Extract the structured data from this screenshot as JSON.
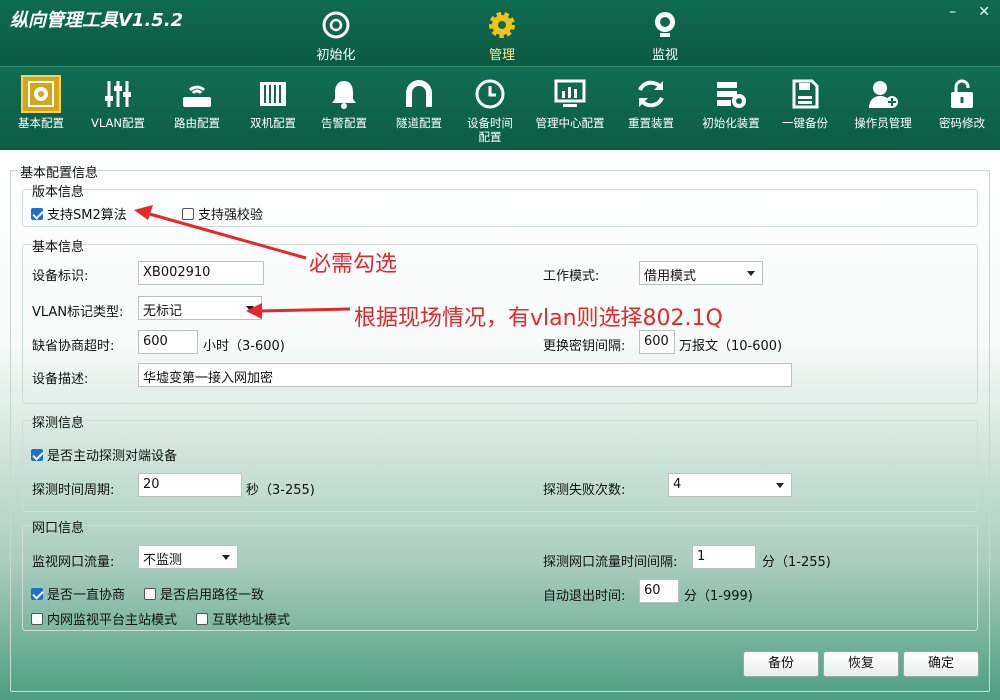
{
  "app": {
    "title": "纵向管理工具V1.5.2",
    "minimize": "–",
    "close": "✕"
  },
  "main_tabs": [
    {
      "label": "初始化",
      "icon": "init-icon"
    },
    {
      "label": "管理",
      "icon": "gear-icon"
    },
    {
      "label": "监视",
      "icon": "camera-icon"
    }
  ],
  "toolbar": [
    {
      "label": "基本配置",
      "icon": "basic-config-icon"
    },
    {
      "label": "VLAN配置",
      "icon": "sliders-icon"
    },
    {
      "label": "路由配置",
      "icon": "router-icon"
    },
    {
      "label": "双机配置",
      "icon": "dual-machine-icon"
    },
    {
      "label": "告警配置",
      "icon": "bell-icon"
    },
    {
      "label": "隧道配置",
      "icon": "tunnel-icon"
    },
    {
      "label": "设备时间",
      "label2": "配置",
      "icon": "clock-icon"
    },
    {
      "label": "管理中心配置",
      "icon": "monitor-icon"
    },
    {
      "label": "重置装置",
      "icon": "refresh-icon"
    },
    {
      "label": "初始化装置",
      "icon": "device-gear-icon"
    },
    {
      "label": "一键备份",
      "icon": "floppy-icon"
    },
    {
      "label": "操作员管理",
      "icon": "user-add-icon"
    },
    {
      "label": "密码修改",
      "icon": "lock-icon"
    }
  ],
  "form": {
    "outer_title": "基本配置信息",
    "version": {
      "title": "版本信息",
      "sm2": {
        "label": "支持SM2算法",
        "checked": true
      },
      "strong_check": {
        "label": "支持强校验",
        "checked": false
      }
    },
    "basic": {
      "title": "基本信息",
      "device_id_label": "设备标识:",
      "device_id_value": "XB002910",
      "work_mode_label": "工作模式:",
      "work_mode_value": "借用模式",
      "vlan_label": "VLAN标记类型:",
      "vlan_value": "无标记",
      "timeout_label": "缺省协商超时:",
      "timeout_value": "600",
      "timeout_unit": "小时（3-600)",
      "key_interval_label": "更换密钥间隔:",
      "key_interval_value": "600",
      "key_interval_unit": "万报文（10-600)",
      "desc_label": "设备描述:",
      "desc_value": "华墟变第一接入网加密"
    },
    "probe": {
      "title": "探测信息",
      "active_probe": {
        "label": "是否主动探测对端设备",
        "checked": true
      },
      "period_label": "探测时间周期:",
      "period_value": "20",
      "period_unit": "秒（3-255)",
      "fail_label": "探测失败次数:",
      "fail_value": "4"
    },
    "net": {
      "title": "网口信息",
      "traffic_label": "监视网口流量:",
      "traffic_value": "不监测",
      "traffic_interval_label": "探测网口流量时间间隔:",
      "traffic_interval_value": "1",
      "traffic_interval_unit": "分（1-255)",
      "always_negotiate": {
        "label": "是否一直协商",
        "checked": true
      },
      "path_consistent": {
        "label": "是否启用路径一致",
        "checked": false
      },
      "auto_exit_label": "自动退出时间:",
      "auto_exit_value": "60",
      "auto_exit_unit": "分（1-999)",
      "intranet_master": {
        "label": "内网监视平台主站模式",
        "checked": false
      },
      "interconnect": {
        "label": "互联地址模式",
        "checked": false
      }
    },
    "buttons": {
      "backup": "备份",
      "restore": "恢复",
      "ok": "确定"
    }
  },
  "annotations": {
    "must_check": "必需勾选",
    "vlan_hint": "根据现场情况，有vlan则选择802.1Q",
    "color": "#e8262c"
  }
}
